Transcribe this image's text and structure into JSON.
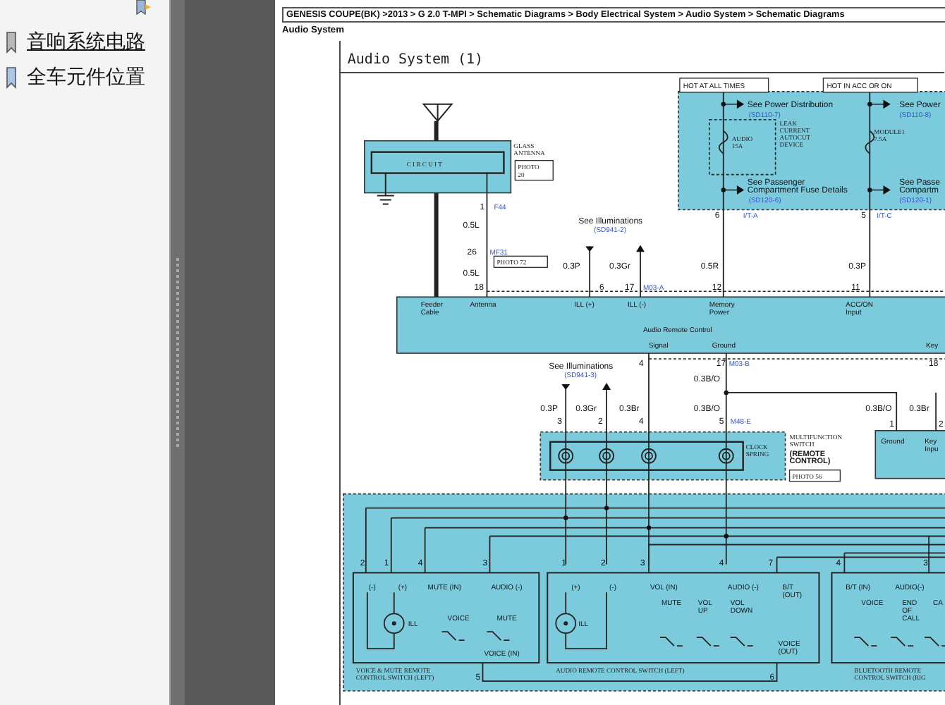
{
  "sidebar": {
    "bookmarks": [
      {
        "label": "音响系统电路",
        "selected": true
      },
      {
        "label": "全车元件位置",
        "selected": false
      }
    ]
  },
  "page": {
    "breadcrumb": "GENESIS COUPE(BK) >2013 > G 2.0 T-MPI > Schematic Diagrams > Body Electrical System > Audio System > Schematic Diagrams",
    "heading": "Audio System",
    "diagram": {
      "title": "Audio System (1)",
      "power_labels": [
        "HOT AT ALL TIMES",
        "HOT IN ACC OR ON"
      ],
      "notes": [
        {
          "text": "See Power Distribution",
          "ref": "(SD110-7)"
        },
        {
          "text": "See Power",
          "ref": "(SD110-8)"
        },
        {
          "text": "See Passenger\nCompartment Fuse Details",
          "ref": "(SD120-6)"
        },
        {
          "text": "See Passe\nCompartm",
          "ref": "(SD120-1)"
        },
        {
          "text": "See Illuminations",
          "ref": "(SD941-2)"
        },
        {
          "text": "See Illuminations",
          "ref": "(SD941-3)"
        }
      ],
      "component_labels": [
        {
          "text": "GLASS\nANTENNA",
          "kind": "plain"
        },
        {
          "text": "C I R C U I T",
          "kind": "plain"
        },
        {
          "text": "AUDIO\n15A",
          "kind": "plain"
        },
        {
          "text": "LEAK\nCURRENT\nAUTOCUT\nDEVICE",
          "kind": "plain"
        },
        {
          "text": "MODULE1\n7.5A",
          "kind": "plain"
        },
        {
          "text": "CLOCK\nSPRING",
          "kind": "plain"
        },
        {
          "text": "MULTIFUNCTION\nSWITCH",
          "kind": "plain"
        },
        {
          "text": "(REMOTE\nCONTROL)",
          "kind": "bold"
        },
        {
          "text": "VOICE & MUTE REMOTE\nCONTROL SWITCH (LEFT)",
          "kind": "plain"
        },
        {
          "text": "AUDIO REMOTE CONTROL SWITCH (LEFT)",
          "kind": "plain"
        },
        {
          "text": "BLUETOOTH REMOTE\nCONTROL SWITCH (RIG",
          "kind": "plain"
        }
      ],
      "photo_refs": [
        "PHOTO\n20",
        "PHOTO 72",
        "PHOTO 56"
      ],
      "wire_labels": [
        "0.5L",
        "0.5L",
        "0.3P",
        "0.3Gr",
        "0.5R",
        "0.3P",
        "0.3B/O",
        "0.3P",
        "0.3Gr",
        "0.3Br",
        "0.3B/O",
        "0.3B/O",
        "0.3Br"
      ],
      "pins": [
        "1",
        "26",
        "18",
        "6",
        "17",
        "12",
        "11",
        "6",
        "5",
        "4",
        "17",
        "18",
        "3",
        "2",
        "4",
        "5",
        "1",
        "2",
        "2",
        "1",
        "4",
        "3",
        "1",
        "2",
        "3",
        "4",
        "7",
        "4",
        "3",
        "5",
        "6"
      ],
      "connector_ids": [
        "F44",
        "MF31",
        "M03-A",
        "I/T-A",
        "I/T-C",
        "M03-B",
        "M48-E"
      ],
      "terminal_labels": [
        "Feeder\nCable",
        "Antenna",
        "ILL (+)",
        "ILL (-)",
        "Memory\nPower",
        "ACC/ON\nInput",
        "Audio Remote Control",
        "Signal",
        "Ground",
        "Key",
        "Ground",
        "Key\nInpu",
        "(-)",
        "(+)",
        "MUTE (IN)",
        "AUDIO (-)",
        "ILL",
        "VOICE",
        "MUTE",
        "VOICE (IN)",
        "(+)",
        "(-)",
        "VOL (IN)",
        "AUDIO (-)",
        "B/T\n(OUT)",
        "ILL",
        "MUTE",
        "VOL\nUP",
        "VOL\nDOWN",
        "VOICE\n(OUT)",
        "B/T (IN)",
        "AUDIO(-)",
        "VOICE",
        "END\nOF\nCALL",
        "CA"
      ]
    }
  }
}
